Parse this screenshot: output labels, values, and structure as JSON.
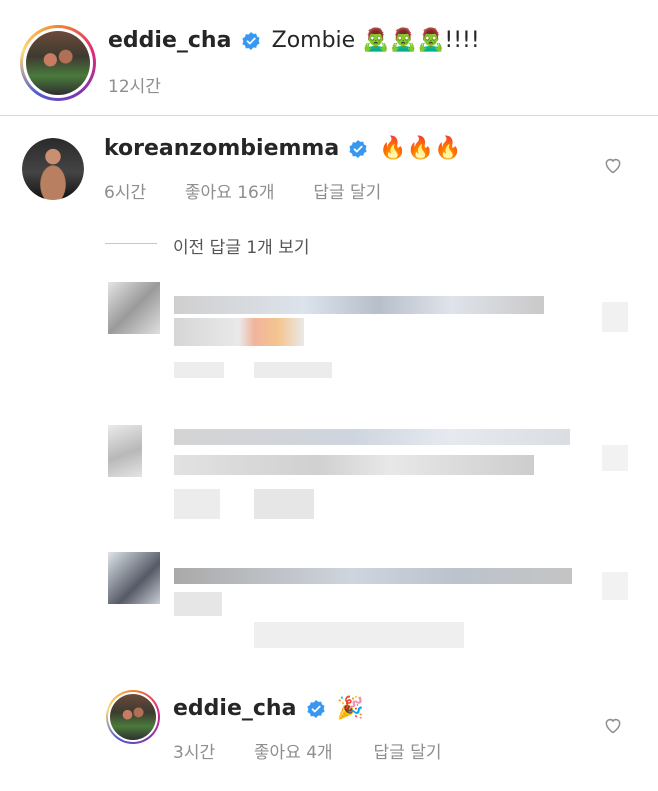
{
  "post": {
    "username": "eddie_cha",
    "text": "Zombie 🧟‍♂️🧟‍♂️🧟‍♂️!!!!",
    "time": "12시간"
  },
  "comment1": {
    "username": "koreanzombiemma",
    "text": "🔥🔥🔥",
    "time": "6시간",
    "likes": "좋아요 16개",
    "reply": "답글 달기"
  },
  "replies_toggle": "이전 답글 1개 보기",
  "reply_last": {
    "username": "eddie_cha",
    "text": "🎉",
    "time": "3시간",
    "likes": "좋아요 4개",
    "reply": "답글 달기"
  },
  "colors": {
    "verified": "#3897f0",
    "text": "#262626",
    "meta": "#8e8e8e"
  },
  "icons": [
    "verified-icon",
    "heart-icon"
  ]
}
